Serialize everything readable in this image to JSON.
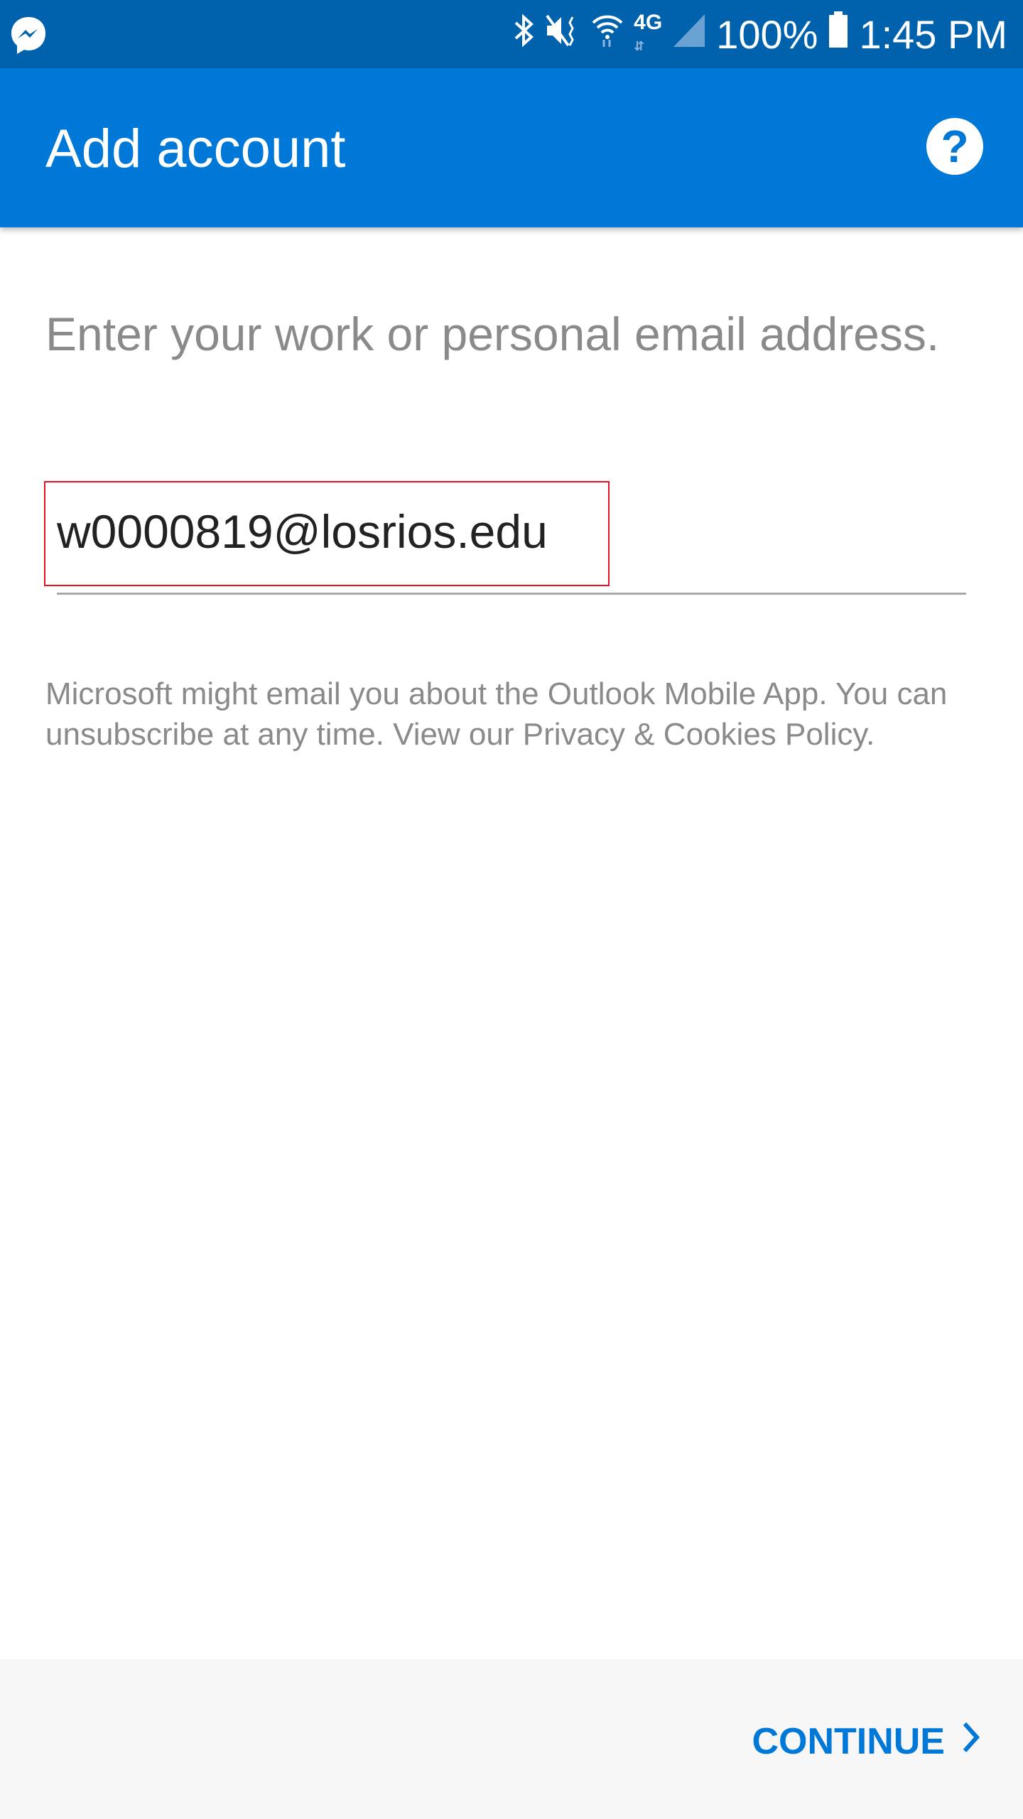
{
  "status_bar": {
    "notification_icon": "messenger-icon",
    "icons": [
      "bluetooth-icon",
      "mute-vibrate-icon",
      "wifi-icon",
      "4g-lte-icon",
      "signal-icon",
      "battery-icon"
    ],
    "battery": "100%",
    "time": "1:45 PM"
  },
  "app_bar": {
    "title": "Add account",
    "help_icon": "help-icon"
  },
  "form": {
    "prompt": "Enter your work or personal email address.",
    "email_value": "w0000819@losrios.edu",
    "disclaimer": "Microsoft might email you about the Outlook Mobile App. You can unsubscribe at any time. View our Privacy & Cookies Policy."
  },
  "footer": {
    "continue_label": "CONTINUE"
  },
  "colors": {
    "status_bar": "#0062ad",
    "app_bar": "#0078d7",
    "accent": "#0078d7",
    "highlight_box": "#e81123"
  }
}
